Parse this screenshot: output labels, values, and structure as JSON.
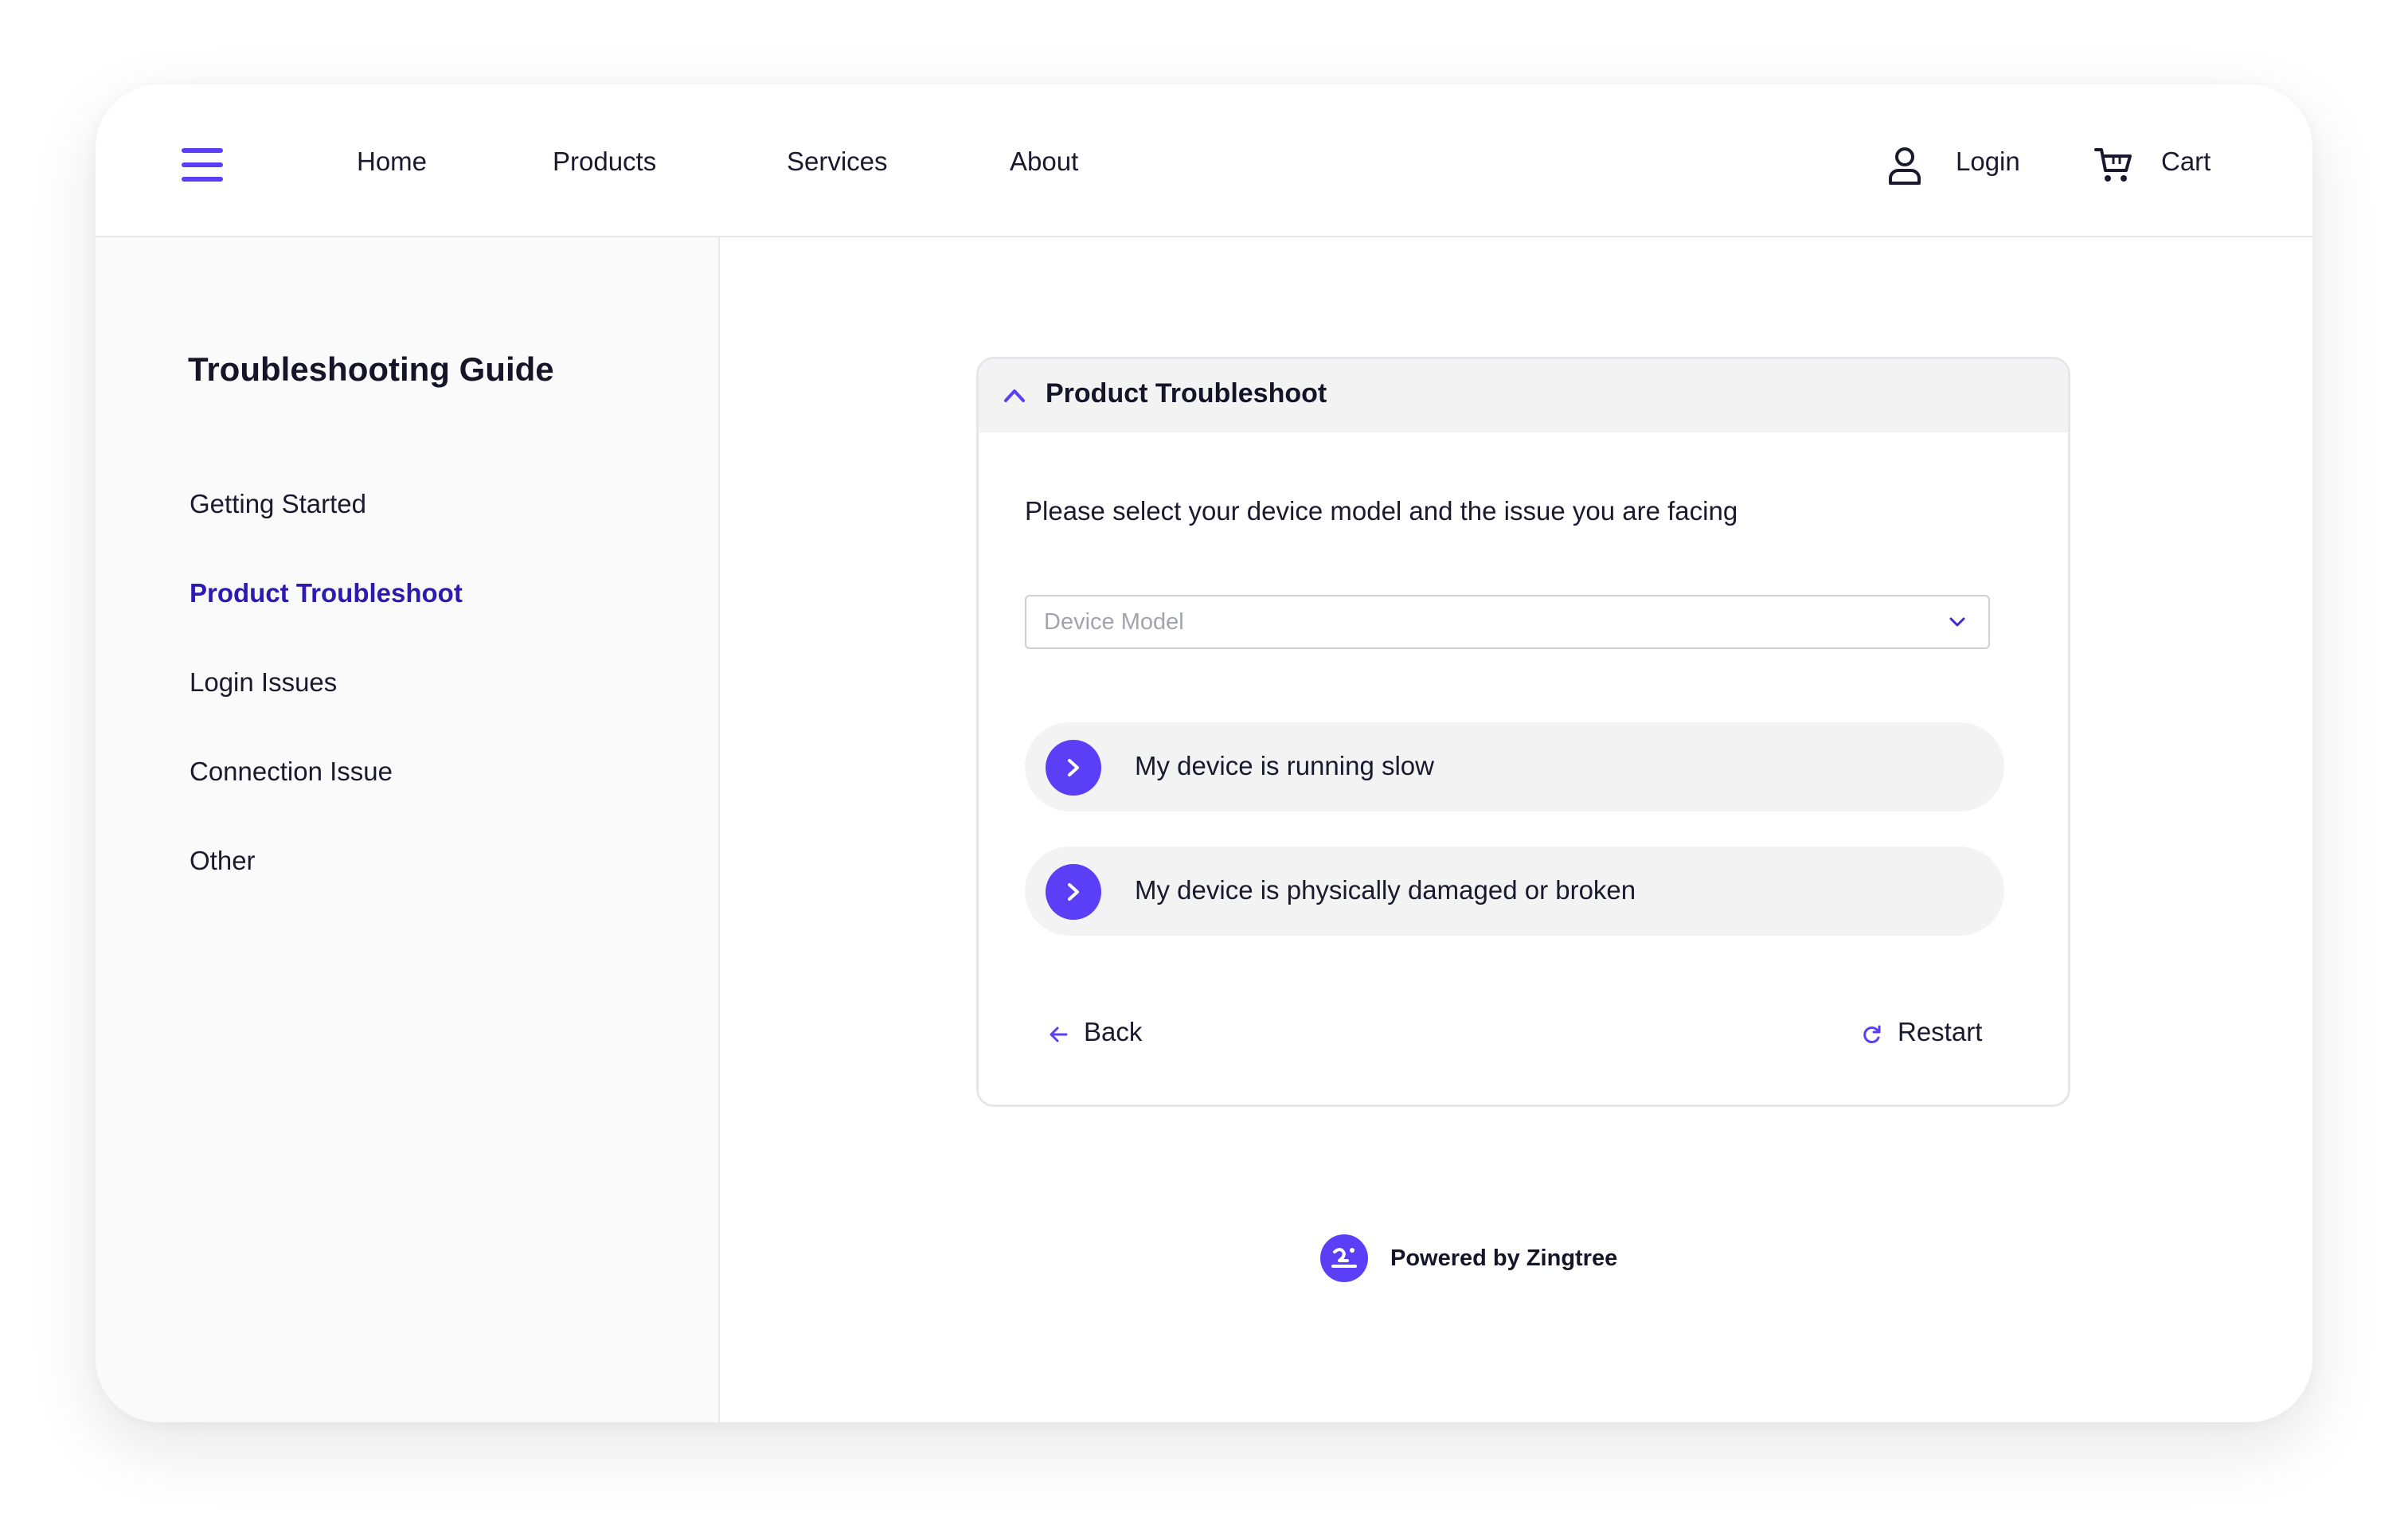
{
  "nav": {
    "links": [
      "Home",
      "Products",
      "Services",
      "About"
    ],
    "login_label": "Login",
    "cart_label": "Cart",
    "menu_icon": "hamburger-menu-icon",
    "user_icon": "user-icon",
    "cart_icon": "cart-icon"
  },
  "sidebar": {
    "title": "Troubleshooting Guide",
    "items": [
      {
        "label": "Getting Started",
        "active": false
      },
      {
        "label": "Product Troubleshoot",
        "active": true
      },
      {
        "label": "Login Issues",
        "active": false
      },
      {
        "label": "Connection Issue",
        "active": false
      },
      {
        "label": "Other",
        "active": false
      }
    ]
  },
  "panel": {
    "title": "Product Troubleshoot",
    "prompt": "Please select your device model and the issue you are facing",
    "select": {
      "placeholder": "Device Model",
      "value": ""
    },
    "options": [
      {
        "label": "My device is running slow"
      },
      {
        "label": "My device is physically damaged or broken"
      }
    ],
    "back_label": "Back",
    "restart_label": "Restart"
  },
  "footer": {
    "powered_label": "Powered by Zingtree"
  },
  "colors": {
    "accent": "#5b3ff6",
    "active_text": "#2b1bb0",
    "option_bg": "#f3f3f4",
    "sidebar_bg": "#fafafa"
  }
}
